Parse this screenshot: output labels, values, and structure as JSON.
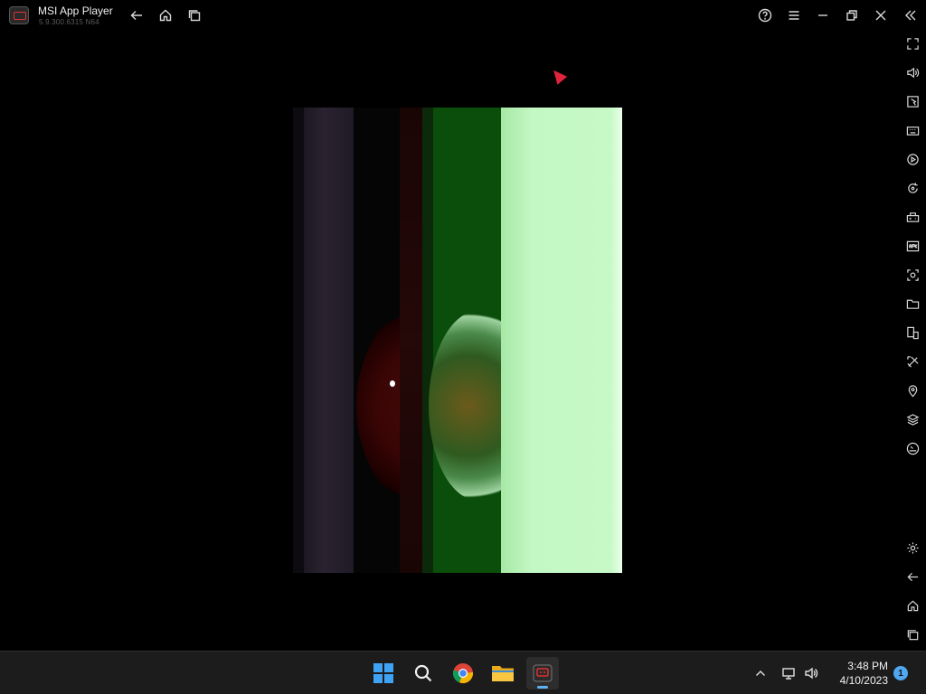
{
  "titlebar": {
    "app_title": "MSI App Player",
    "app_version": "5.9.300.6315 N64",
    "icons": [
      "back-icon",
      "home-icon",
      "recent-apps-icon",
      "help-icon",
      "menu-icon",
      "minimize-icon",
      "restore-icon",
      "close-icon",
      "collapse-sidebar-icon"
    ]
  },
  "sidebar": {
    "icons": [
      "fullscreen-icon",
      "volume-icon",
      "pointer-icon",
      "keyboard-icon",
      "macro-icon",
      "rotate-icon",
      "gamepad-icon",
      "apk-icon",
      "screenshot-icon",
      "folder-icon",
      "multi-instance-icon",
      "eco-mode-icon",
      "location-icon",
      "layers-icon",
      "performance-icon",
      "settings-icon",
      "back-icon",
      "home-icon",
      "recent-apps-icon"
    ]
  },
  "screen": {
    "content": "video-frame",
    "colors": {
      "green_dark": "#0b4d0b",
      "green_light": "#c3f7c3",
      "purple": "#2a2230",
      "cursor": "#e0243c"
    }
  },
  "taskbar": {
    "apps": [
      "start-icon",
      "search-icon",
      "chrome-icon",
      "file-explorer-icon",
      "msi-app-player-icon"
    ],
    "time": "3:48 PM",
    "date": "4/10/2023",
    "notification_count": "1"
  }
}
